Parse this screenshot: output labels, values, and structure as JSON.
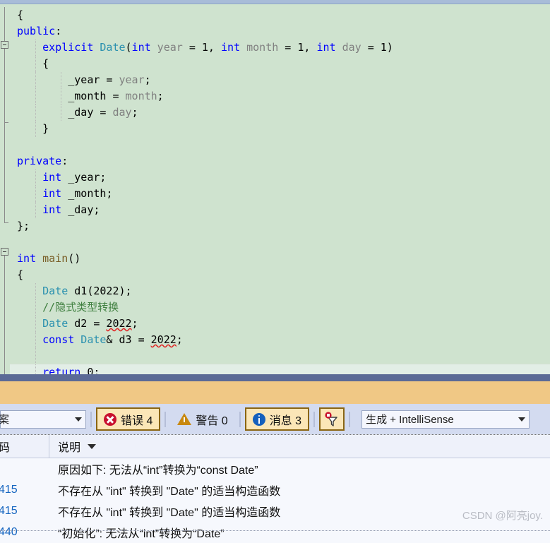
{
  "editor": {
    "language": "cpp",
    "background_color": "#cfe3cf",
    "lines": [
      {
        "indent": 0,
        "tokens": [
          {
            "t": "{",
            "c": "plain"
          }
        ]
      },
      {
        "indent": 0,
        "tokens": [
          {
            "t": "public",
            "c": "kw"
          },
          {
            "t": ":",
            "c": "plain"
          }
        ]
      },
      {
        "indent": 1,
        "tokens": [
          {
            "t": "explicit",
            "c": "kw"
          },
          {
            "t": " ",
            "c": "plain"
          },
          {
            "t": "Date",
            "c": "type"
          },
          {
            "t": "(",
            "c": "plain"
          },
          {
            "t": "int",
            "c": "kw"
          },
          {
            "t": " ",
            "c": "plain"
          },
          {
            "t": "year",
            "c": "param"
          },
          {
            "t": " = ",
            "c": "plain"
          },
          {
            "t": "1",
            "c": "num"
          },
          {
            "t": ", ",
            "c": "plain"
          },
          {
            "t": "int",
            "c": "kw"
          },
          {
            "t": " ",
            "c": "plain"
          },
          {
            "t": "month",
            "c": "param"
          },
          {
            "t": " = ",
            "c": "plain"
          },
          {
            "t": "1",
            "c": "num"
          },
          {
            "t": ", ",
            "c": "plain"
          },
          {
            "t": "int",
            "c": "kw"
          },
          {
            "t": " ",
            "c": "plain"
          },
          {
            "t": "day",
            "c": "param"
          },
          {
            "t": " = ",
            "c": "plain"
          },
          {
            "t": "1",
            "c": "num"
          },
          {
            "t": ")",
            "c": "plain"
          }
        ]
      },
      {
        "indent": 1,
        "tokens": [
          {
            "t": "{",
            "c": "plain"
          }
        ]
      },
      {
        "indent": 2,
        "tokens": [
          {
            "t": "_year",
            "c": "plain"
          },
          {
            "t": " = ",
            "c": "plain"
          },
          {
            "t": "year",
            "c": "param"
          },
          {
            "t": ";",
            "c": "plain"
          }
        ]
      },
      {
        "indent": 2,
        "tokens": [
          {
            "t": "_month",
            "c": "plain"
          },
          {
            "t": " = ",
            "c": "plain"
          },
          {
            "t": "month",
            "c": "param"
          },
          {
            "t": ";",
            "c": "plain"
          }
        ]
      },
      {
        "indent": 2,
        "tokens": [
          {
            "t": "_day",
            "c": "plain"
          },
          {
            "t": " = ",
            "c": "plain"
          },
          {
            "t": "day",
            "c": "param"
          },
          {
            "t": ";",
            "c": "plain"
          }
        ]
      },
      {
        "indent": 1,
        "tokens": [
          {
            "t": "}",
            "c": "plain"
          }
        ]
      },
      {
        "indent": 0,
        "tokens": []
      },
      {
        "indent": 0,
        "tokens": [
          {
            "t": "private",
            "c": "kw"
          },
          {
            "t": ":",
            "c": "plain"
          }
        ]
      },
      {
        "indent": 1,
        "tokens": [
          {
            "t": "int",
            "c": "kw"
          },
          {
            "t": " _year;",
            "c": "plain"
          }
        ]
      },
      {
        "indent": 1,
        "tokens": [
          {
            "t": "int",
            "c": "kw"
          },
          {
            "t": " _month;",
            "c": "plain"
          }
        ]
      },
      {
        "indent": 1,
        "tokens": [
          {
            "t": "int",
            "c": "kw"
          },
          {
            "t": " _day;",
            "c": "plain"
          }
        ]
      },
      {
        "indent": 0,
        "tokens": [
          {
            "t": "};",
            "c": "plain"
          }
        ]
      },
      {
        "indent": 0,
        "tokens": []
      },
      {
        "indent": 0,
        "tokens": [
          {
            "t": "int",
            "c": "kw"
          },
          {
            "t": " ",
            "c": "plain"
          },
          {
            "t": "main",
            "c": "fn"
          },
          {
            "t": "()",
            "c": "plain"
          }
        ]
      },
      {
        "indent": 0,
        "tokens": [
          {
            "t": "{",
            "c": "plain"
          }
        ]
      },
      {
        "indent": 1,
        "tokens": [
          {
            "t": "Date",
            "c": "type"
          },
          {
            "t": " d1(",
            "c": "plain"
          },
          {
            "t": "2022",
            "c": "num"
          },
          {
            "t": ");",
            "c": "plain"
          }
        ]
      },
      {
        "indent": 1,
        "tokens": [
          {
            "t": "//隐式类型转换",
            "c": "cmt"
          }
        ]
      },
      {
        "indent": 1,
        "tokens": [
          {
            "t": "Date",
            "c": "type"
          },
          {
            "t": " d2 = ",
            "c": "plain"
          },
          {
            "t": "2022",
            "c": "num",
            "squiggle": true
          },
          {
            "t": ";",
            "c": "plain"
          }
        ]
      },
      {
        "indent": 1,
        "tokens": [
          {
            "t": "const",
            "c": "kw"
          },
          {
            "t": " ",
            "c": "plain"
          },
          {
            "t": "Date",
            "c": "type"
          },
          {
            "t": "& d3 = ",
            "c": "plain"
          },
          {
            "t": "2022",
            "c": "num",
            "squiggle": true
          },
          {
            "t": ";",
            "c": "plain"
          }
        ]
      },
      {
        "indent": 1,
        "tokens": []
      },
      {
        "indent": 1,
        "highlight": true,
        "tokens": [
          {
            "t": "return",
            "c": "kw"
          },
          {
            "t": " ",
            "c": "plain"
          },
          {
            "t": "0",
            "c": "num"
          },
          {
            "t": ";",
            "c": "plain"
          }
        ]
      },
      {
        "indent": 0,
        "tokens": [
          {
            "t": "}",
            "c": "plain"
          }
        ]
      }
    ]
  },
  "error_list": {
    "toolbar": {
      "scope_filter": {
        "value": "案",
        "full_value_hint": "整个解决方案"
      },
      "errors_button": {
        "label": "错误 4",
        "icon": "error-icon",
        "count": 4,
        "active": true
      },
      "warnings_button": {
        "label": "警告 0",
        "icon": "warning-icon",
        "count": 0,
        "active": false
      },
      "messages_button": {
        "label": "消息 3",
        "icon": "info-icon",
        "count": 3,
        "active": true
      },
      "filter_button": {
        "icon": "filter-icon",
        "active": true
      },
      "build_filter": {
        "value": "生成 + IntelliSense"
      }
    },
    "columns": [
      {
        "key": "code",
        "label": "码",
        "full_label_hint": "代码"
      },
      {
        "key": "description",
        "label": "说明",
        "sorted": true
      }
    ],
    "rows": [
      {
        "code": "",
        "description": "原因如下: 无法从“int”转换为“const Date”"
      },
      {
        "code": "415",
        "description": "不存在从 \"int\" 转换到 \"Date\" 的适当构造函数"
      },
      {
        "code": "415",
        "description": "不存在从 \"int\" 转换到 \"Date\" 的适当构造函数"
      },
      {
        "code": "440",
        "description": "“初始化”: 无法从“int”转换为“Date”"
      }
    ]
  },
  "watermark": {
    "text": "CSDN @阿亮joy."
  },
  "colors": {
    "editor_bg": "#cfe3cf",
    "keyword": "#0000ff",
    "type": "#2b91af",
    "function": "#795e26",
    "parameter": "#808080",
    "comment": "#3f7f3f",
    "error_squiggle": "#e02020",
    "splitter": "#5b6a96",
    "orange_band": "#f0c885",
    "toolbar_bg": "#d3dbf0",
    "active_button_bg": "#fbe6b7",
    "active_button_border": "#8a6513",
    "error_icon": "#c8102e",
    "warning_icon": "#c8880f",
    "info_icon": "#1560bd",
    "code_link": "#1565c0"
  }
}
